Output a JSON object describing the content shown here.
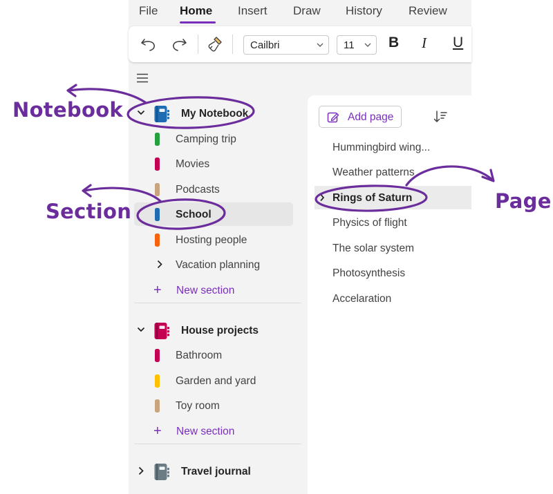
{
  "menu": {
    "items": [
      {
        "label": "File"
      },
      {
        "label": "Home"
      },
      {
        "label": "Insert"
      },
      {
        "label": "Draw"
      },
      {
        "label": "History"
      },
      {
        "label": "Review"
      }
    ],
    "active": "Home"
  },
  "ribbon": {
    "font_name": "Cailbri",
    "font_size": "11",
    "bold_label": "B",
    "italic_label": "I",
    "underline_label": "U"
  },
  "notebooks": [
    {
      "label": "My Notebook",
      "expanded": true,
      "color": "#1f6cb3",
      "sections": [
        {
          "label": "Camping trip",
          "color": "#25a03f"
        },
        {
          "label": "Movies",
          "color": "#c30052"
        },
        {
          "label": "Podcasts",
          "color": "#c8a57e"
        },
        {
          "label": "School",
          "color": "#1f6cb3",
          "selected": true
        },
        {
          "label": "Hosting people",
          "color": "#f7630c"
        },
        {
          "label": "Vacation planning",
          "group": true
        }
      ],
      "new_section_label": "New section"
    },
    {
      "label": "House projects",
      "expanded": true,
      "color": "#c30052",
      "sections": [
        {
          "label": "Bathroom",
          "color": "#c30052"
        },
        {
          "label": "Garden and yard",
          "color": "#ffc000"
        },
        {
          "label": "Toy room",
          "color": "#c8a57e"
        }
      ],
      "new_section_label": "New section"
    },
    {
      "label": "Travel journal",
      "expanded": false,
      "color": "#6b7c84"
    }
  ],
  "pages": {
    "add_page_label": "Add page",
    "items": [
      {
        "label": "Hummingbird wing..."
      },
      {
        "label": "Weather patterns"
      },
      {
        "label": "Rings of Saturn",
        "selected": true
      },
      {
        "label": "Physics of flight"
      },
      {
        "label": "The solar system"
      },
      {
        "label": "Photosynthesis"
      },
      {
        "label": "Accelaration"
      }
    ]
  },
  "annotations": {
    "notebook": "Notebook",
    "section": "Section",
    "page": "Page",
    "color": "#6b2d9c"
  },
  "theme": {
    "accent": "#7a2ebe",
    "pane_bg": "#f3f3f3",
    "selection": "#e6e6e6"
  }
}
